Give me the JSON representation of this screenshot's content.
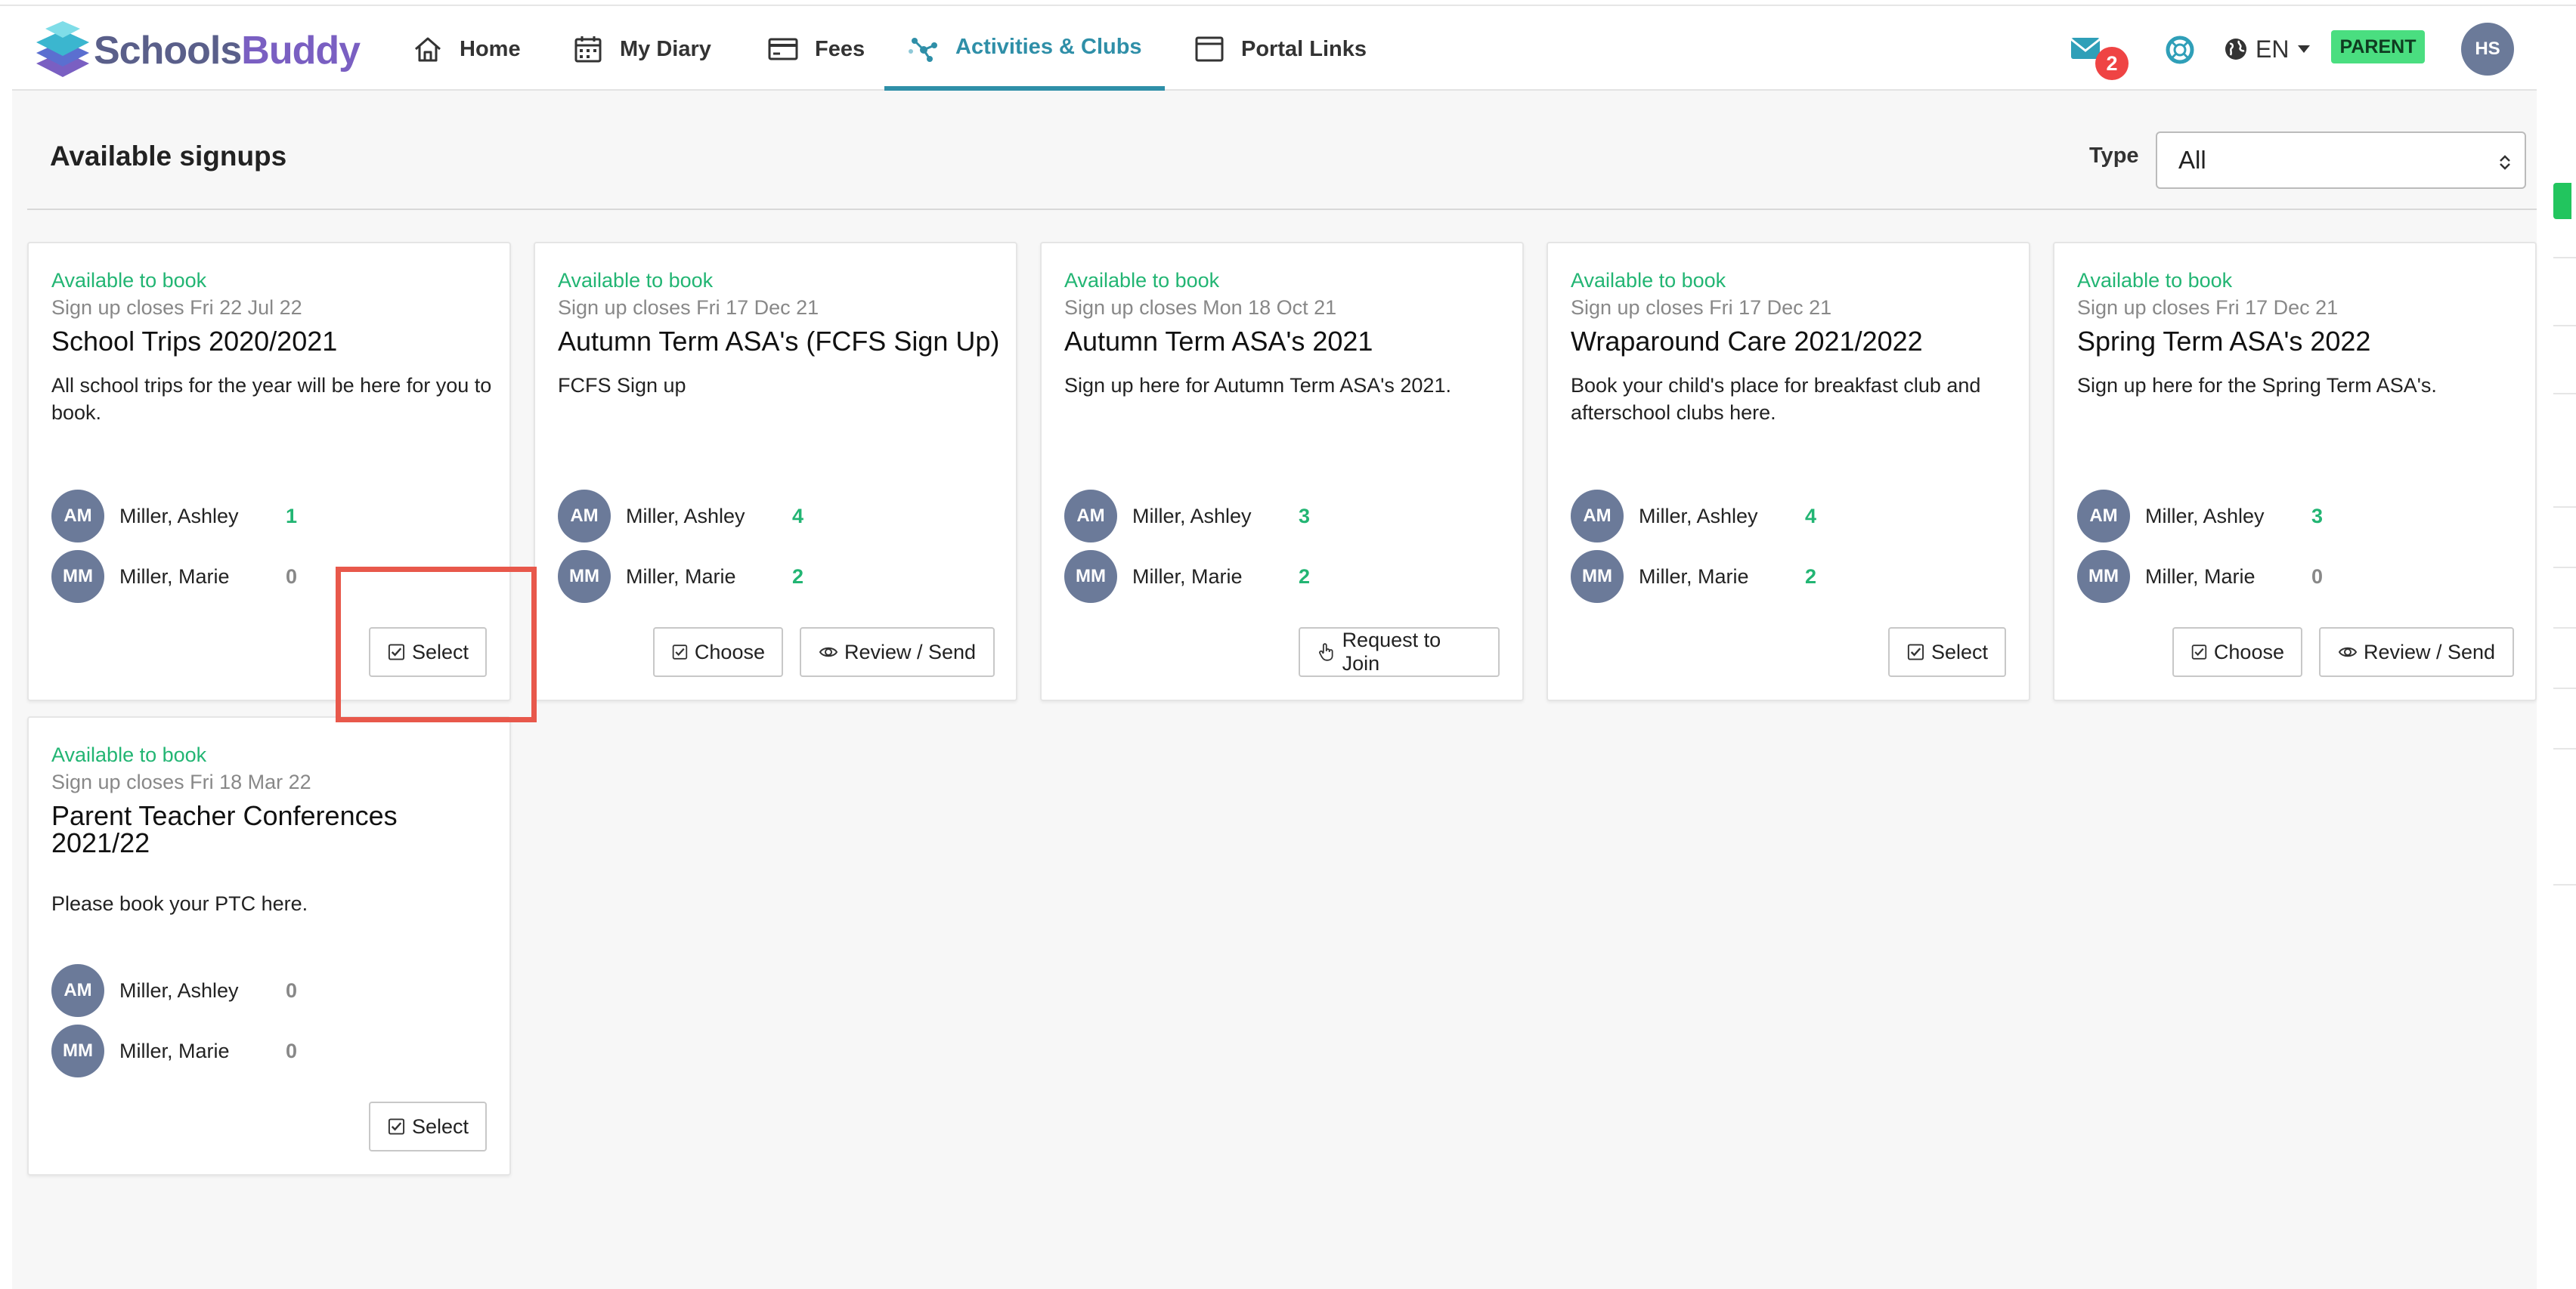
{
  "header": {
    "logo": {
      "part1": "Schools",
      "part2": "Buddy"
    },
    "nav": [
      {
        "label": "Home",
        "icon": "home-icon",
        "active": false
      },
      {
        "label": "My Diary",
        "icon": "calendar-icon",
        "active": false
      },
      {
        "label": "Fees",
        "icon": "credit-card-icon",
        "active": false
      },
      {
        "label": "Activities & Clubs",
        "icon": "activities-icon",
        "active": true
      },
      {
        "label": "Portal Links",
        "icon": "browser-window-icon",
        "active": false
      }
    ],
    "mail_count": "2",
    "language": "EN",
    "role": "PARENT",
    "user_initials": "HS"
  },
  "toolbar": {
    "title": "Available signups",
    "type_label": "Type",
    "type_value": "All"
  },
  "cards": [
    {
      "status": "Available to book",
      "closes": "Sign up closes Fri 22 Jul 22",
      "title": "School Trips 2020/2021",
      "description": "All school trips for the year will be here for you to book.",
      "children": [
        {
          "initials": "AM",
          "name": "Miller, Ashley",
          "count": "1"
        },
        {
          "initials": "MM",
          "name": "Miller, Marie",
          "count": "0"
        }
      ],
      "buttons": [
        {
          "label": "Select",
          "icon": "checkbox-icon"
        }
      ]
    },
    {
      "status": "Available to book",
      "closes": "Sign up closes Fri 17 Dec 21",
      "title": "Autumn Term ASA's (FCFS Sign Up)",
      "description": "FCFS Sign up",
      "children": [
        {
          "initials": "AM",
          "name": "Miller, Ashley",
          "count": "4"
        },
        {
          "initials": "MM",
          "name": "Miller, Marie",
          "count": "2"
        }
      ],
      "buttons": [
        {
          "label": "Choose",
          "icon": "checkbox-icon"
        },
        {
          "label": "Review / Send",
          "icon": "eye-icon"
        }
      ]
    },
    {
      "status": "Available to book",
      "closes": "Sign up closes Mon 18 Oct 21",
      "title": "Autumn Term ASA's 2021",
      "description": "Sign up here for Autumn Term ASA's 2021.",
      "children": [
        {
          "initials": "AM",
          "name": "Miller, Ashley",
          "count": "3"
        },
        {
          "initials": "MM",
          "name": "Miller, Marie",
          "count": "2"
        }
      ],
      "buttons": [
        {
          "label": "Request to Join",
          "icon": "hand-pointer-icon"
        }
      ]
    },
    {
      "status": "Available to book",
      "closes": "Sign up closes Fri 17 Dec 21",
      "title": "Wraparound Care 2021/2022",
      "description": "Book your child's place for breakfast club and afterschool clubs here.",
      "children": [
        {
          "initials": "AM",
          "name": "Miller, Ashley",
          "count": "4"
        },
        {
          "initials": "MM",
          "name": "Miller, Marie",
          "count": "2"
        }
      ],
      "buttons": [
        {
          "label": "Select",
          "icon": "checkbox-icon"
        }
      ]
    },
    {
      "status": "Available to book",
      "closes": "Sign up closes Fri 17 Dec 21",
      "title": "Spring Term ASA's 2022",
      "description": "Sign up here for the Spring Term ASA's.",
      "children": [
        {
          "initials": "AM",
          "name": "Miller, Ashley",
          "count": "3"
        },
        {
          "initials": "MM",
          "name": "Miller, Marie",
          "count": "0"
        }
      ],
      "buttons": [
        {
          "label": "Choose",
          "icon": "checkbox-icon"
        },
        {
          "label": "Review / Send",
          "icon": "eye-icon"
        }
      ]
    },
    {
      "status": "Available to book",
      "closes": "Sign up closes Fri 18 Mar 22",
      "title": "Parent Teacher Conferences 2021/22",
      "description": "Please book your PTC here.",
      "children": [
        {
          "initials": "AM",
          "name": "Miller, Ashley",
          "count": "0"
        },
        {
          "initials": "MM",
          "name": "Miller, Marie",
          "count": "0"
        }
      ],
      "buttons": [
        {
          "label": "Select",
          "icon": "checkbox-icon"
        }
      ]
    }
  ]
}
